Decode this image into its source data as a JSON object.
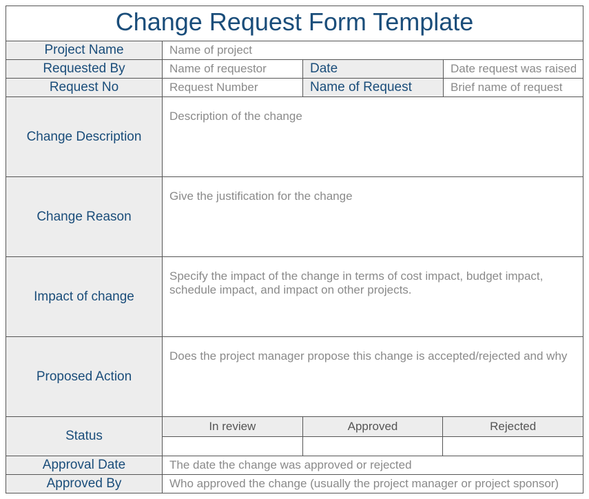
{
  "title": "Change Request Form Template",
  "labels": {
    "project_name": "Project Name",
    "requested_by": "Requested By",
    "date": "Date",
    "request_no": "Request No",
    "name_of_request": "Name of Request",
    "change_description": "Change Description",
    "change_reason": "Change Reason",
    "impact_of_change": "Impact of change",
    "proposed_action": "Proposed Action",
    "status": "Status",
    "approval_date": "Approval Date",
    "approved_by": "Approved By"
  },
  "placeholders": {
    "project_name": "Name of project",
    "requested_by": "Name of requestor",
    "date": "Date request was raised",
    "request_no": "Request Number",
    "name_of_request": "Brief name of request",
    "change_description": "Description of the change",
    "change_reason": "Give the justification for the change",
    "impact_of_change": "Specify the impact of the change in terms of cost impact, budget impact, schedule impact, and impact on other projects.",
    "proposed_action": "Does the project manager propose this change is accepted/rejected and why",
    "approval_date": "The date the change was approved or rejected",
    "approved_by": "Who approved the change (usually the project manager or project sponsor)"
  },
  "status_options": {
    "in_review": "In review",
    "approved": "Approved",
    "rejected": "Rejected"
  }
}
